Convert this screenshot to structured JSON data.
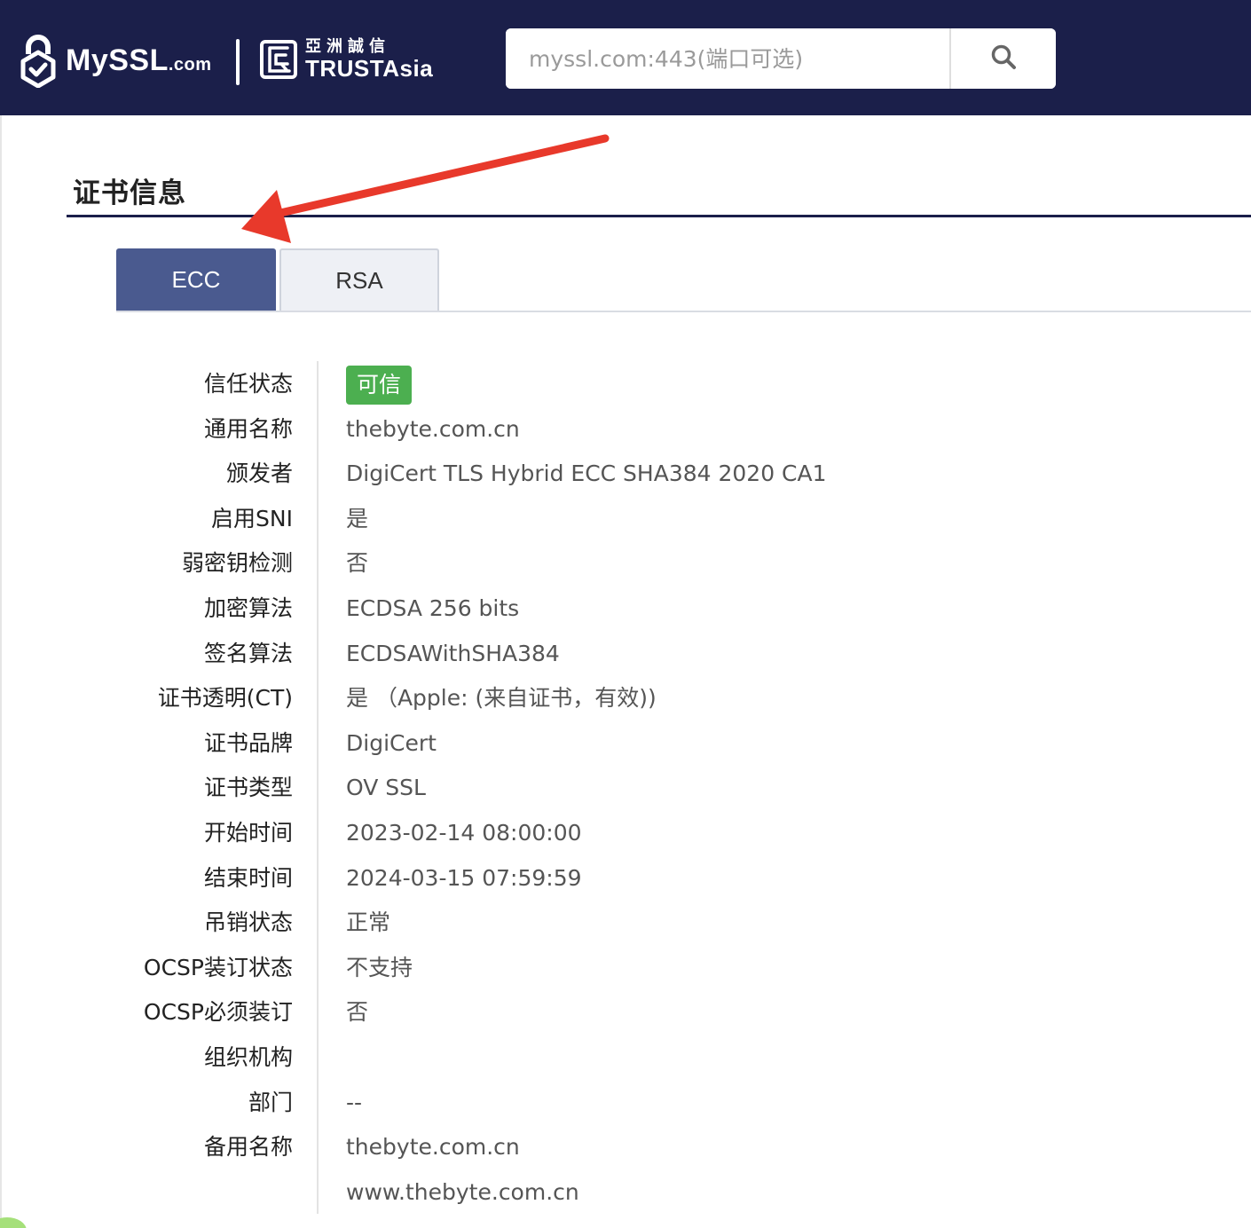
{
  "header": {
    "brand_name": "MySSL",
    "brand_suffix": ".com",
    "partner_cn": "亞洲誠信",
    "partner_en": "TRUSTAsia",
    "search_placeholder": "myssl.com:443(端口可选)"
  },
  "section": {
    "title": "证书信息"
  },
  "tabs": [
    {
      "label": "ECC",
      "active": true
    },
    {
      "label": "RSA",
      "active": false
    }
  ],
  "cert": {
    "rows": [
      {
        "label": "信任状态",
        "value": "可信",
        "badge": true
      },
      {
        "label": "通用名称",
        "value": "thebyte.com.cn"
      },
      {
        "label": "颁发者",
        "value": "DigiCert TLS Hybrid ECC SHA384 2020 CA1"
      },
      {
        "label": "启用SNI",
        "value": "是"
      },
      {
        "label": "弱密钥检测",
        "value": "否"
      },
      {
        "label": "加密算法",
        "value": "ECDSA 256 bits"
      },
      {
        "label": "签名算法",
        "value": "ECDSAWithSHA384"
      },
      {
        "label": "证书透明(CT)",
        "value": "是 （Apple: (来自证书，有效))"
      },
      {
        "label": "证书品牌",
        "value": "DigiCert"
      },
      {
        "label": "证书类型",
        "value": "OV SSL"
      },
      {
        "label": "开始时间",
        "value": "2023-02-14 08:00:00"
      },
      {
        "label": "结束时间",
        "value": "2024-03-15 07:59:59"
      },
      {
        "label": "吊销状态",
        "value": "正常"
      },
      {
        "label": "OCSP装订状态",
        "value": "不支持"
      },
      {
        "label": "OCSP必须装订",
        "value": "否"
      },
      {
        "label": "组织机构",
        "value": ""
      },
      {
        "label": "部门",
        "value": "--"
      },
      {
        "label": "备用名称",
        "value": "thebyte.com.cn"
      },
      {
        "label": "",
        "value": "www.thebyte.com.cn"
      }
    ]
  },
  "colors": {
    "header_bg": "#1b1f4a",
    "tab_active_bg": "#4a5a8f",
    "badge_green": "#4caf50",
    "annotation_red": "#e8392b"
  },
  "icons": {
    "brand": "lock-check-icon",
    "partner": "trustasia-badge-icon",
    "search": "search-icon",
    "annotation": "arrow-annotation-icon"
  }
}
